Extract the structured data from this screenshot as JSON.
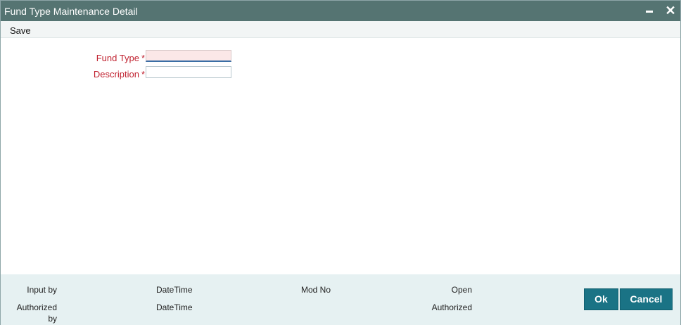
{
  "window": {
    "title": "Fund Type Maintenance Detail",
    "minimize_icon": "minimize-icon",
    "close_icon": "close-icon",
    "close_glyph": "✕"
  },
  "toolbar": {
    "save_label": "Save"
  },
  "form": {
    "fund_type": {
      "label": "Fund Type",
      "required_mark": "*",
      "value": "",
      "placeholder": ""
    },
    "description": {
      "label": "Description",
      "required_mark": "*",
      "value": "",
      "placeholder": ""
    }
  },
  "footer": {
    "input_by_label": "Input by",
    "datetime_label_1": "DateTime",
    "mod_no_label": "Mod No",
    "open_label": "Open",
    "authorized_by_label_line1": "Authorized",
    "authorized_by_label_line2": "by",
    "datetime_label_2": "DateTime",
    "authorized_label": "Authorized",
    "ok_label": "Ok",
    "cancel_label": "Cancel"
  },
  "colors": {
    "titlebar": "#557472",
    "required_label": "#c0212f",
    "footer_bg": "#e6f1f2",
    "button_bg": "#1a7385"
  }
}
